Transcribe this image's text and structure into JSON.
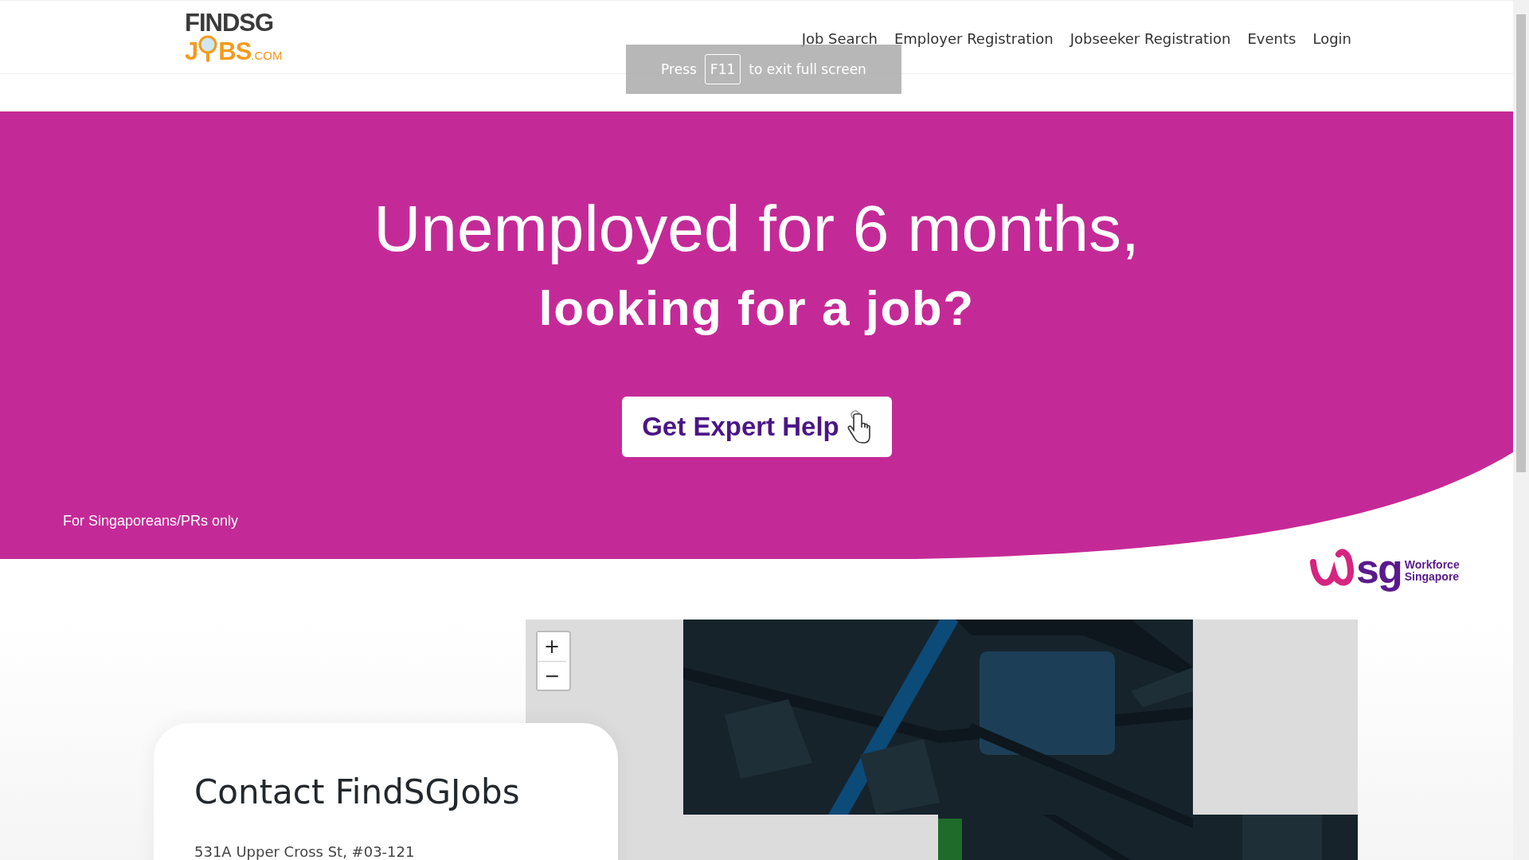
{
  "logo": {
    "top": "FINDSG",
    "bottom_left": "J",
    "bottom_right": "BS",
    "suffix": ".COM"
  },
  "nav": [
    {
      "label": "Job Search"
    },
    {
      "label": "Employer Registration"
    },
    {
      "label": "Jobseeker Registration"
    },
    {
      "label": "Events"
    },
    {
      "label": "Login"
    }
  ],
  "fullscreen_notice": {
    "before": "Press",
    "key": "F11",
    "after": "to exit full screen"
  },
  "hero": {
    "headline": "Unemployed for 6 months,",
    "subheadline": "looking for a job?",
    "button": "Get Expert Help",
    "note": "For Singaporeans/PRs only"
  },
  "partner_logo": {
    "letters": "sg",
    "line1": "Workforce",
    "line2": "Singapore"
  },
  "map": {
    "kind": "picture",
    "zoom_in": "+",
    "zoom_out": "−"
  },
  "contact": {
    "title": "Contact FindSGJobs",
    "address": "531A Upper Cross St, #03-121"
  }
}
